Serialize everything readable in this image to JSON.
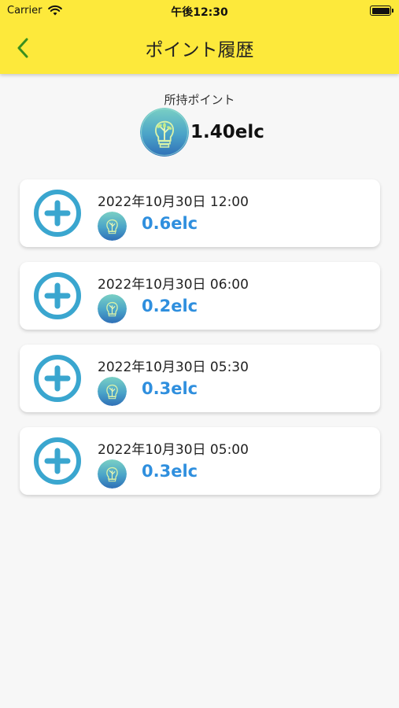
{
  "status_bar": {
    "carrier": "Carrier",
    "time": "午後12:30"
  },
  "header": {
    "title": "ポイント履歴",
    "back_icon": "chevron-left-icon"
  },
  "balance": {
    "label": "所持ポイント",
    "value": "1.40elc",
    "icon": "elc-coin-icon"
  },
  "history": [
    {
      "datetime": "2022年10月30日 12:00",
      "amount": "0.6elc",
      "type": "plus-circle-icon"
    },
    {
      "datetime": "2022年10月30日 06:00",
      "amount": "0.2elc",
      "type": "plus-circle-icon"
    },
    {
      "datetime": "2022年10月30日 05:30",
      "amount": "0.3elc",
      "type": "plus-circle-icon"
    },
    {
      "datetime": "2022年10月30日 05:00",
      "amount": "0.3elc",
      "type": "plus-circle-icon"
    }
  ],
  "colors": {
    "header_bg": "#fde93b",
    "back_arrow": "#3b8f1e",
    "plus_icon": "#3aa6cf",
    "amount_text": "#2f8fde",
    "page_bg": "#f7f7f7"
  }
}
